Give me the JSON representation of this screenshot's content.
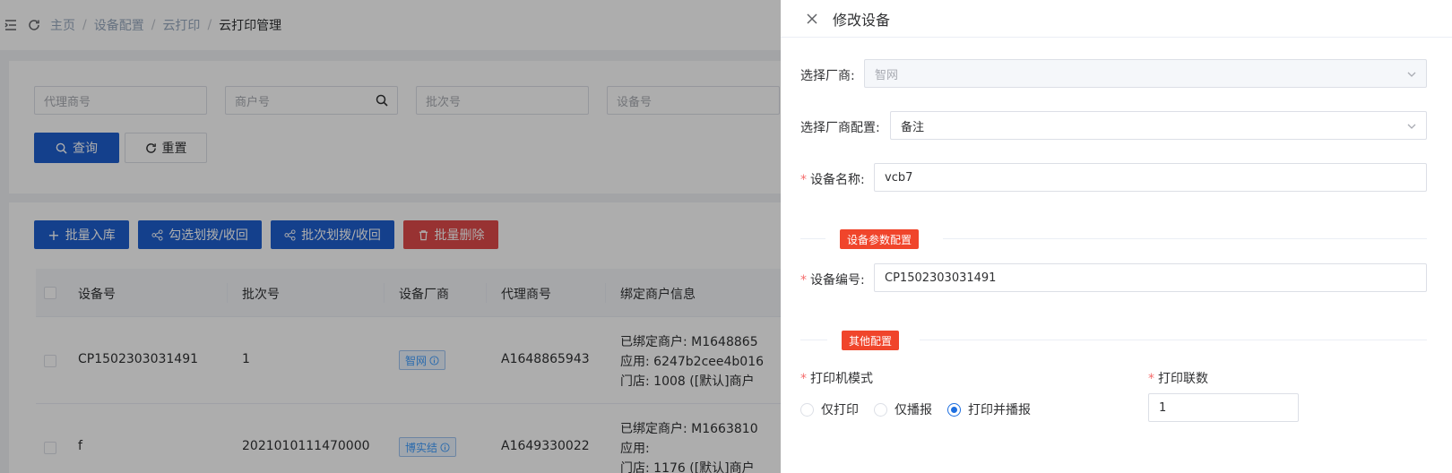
{
  "breadcrumb": [
    "主页",
    "设备配置",
    "云打印",
    "云打印管理"
  ],
  "filters": {
    "agent_placeholder": "代理商号",
    "merchant_placeholder": "商户号",
    "batch_placeholder": "批次号",
    "device_placeholder": "设备号"
  },
  "actions": {
    "query": "查询",
    "reset": "重置",
    "batch_in": "批量入库",
    "select_transfer": "勾选划拨/收回",
    "batch_transfer": "批次划拨/收回",
    "batch_delete": "批量删除"
  },
  "table": {
    "columns": [
      "设备号",
      "批次号",
      "设备厂商",
      "代理商号",
      "绑定商户信息"
    ],
    "rows": [
      {
        "device": "CP1502303031491",
        "batch": "1",
        "vendor": "智网",
        "agent": "A1648865943",
        "info1": "已绑定商户: M1648865",
        "info2": "应用:   6247b2cee4b016",
        "info3": "门店:   1008 ([默认]商户"
      },
      {
        "device": "f",
        "batch": "2021010111470000",
        "vendor": "博实结",
        "agent": "A1649330022",
        "info1": "已绑定商户: M1663810",
        "info2": "应用:",
        "info3": "门店:   1176 ([默认]商户"
      }
    ]
  },
  "drawer": {
    "title": "修改设备",
    "vendor_label": "选择厂商:",
    "vendor_value": "智网",
    "vendor_config_label": "选择厂商配置:",
    "vendor_config_value": "备注",
    "device_name_label": "设备名称:",
    "device_name_value": "vcb7",
    "section_params": "设备参数配置",
    "device_no_label": "设备编号:",
    "device_no_value": "CP1502303031491",
    "section_other": "其他配置",
    "print_mode_label": "打印机模式",
    "print_mode_options": [
      "仅打印",
      "仅播报",
      "打印并播报"
    ],
    "print_mode_selected": "打印并播报",
    "print_copies_label": "打印联数",
    "print_copies_value": "1"
  },
  "colors": {
    "primary": "#1e5fcf",
    "danger": "#e04a4a",
    "badge": "#f0452b",
    "radio_active": "#1e6fe0"
  }
}
